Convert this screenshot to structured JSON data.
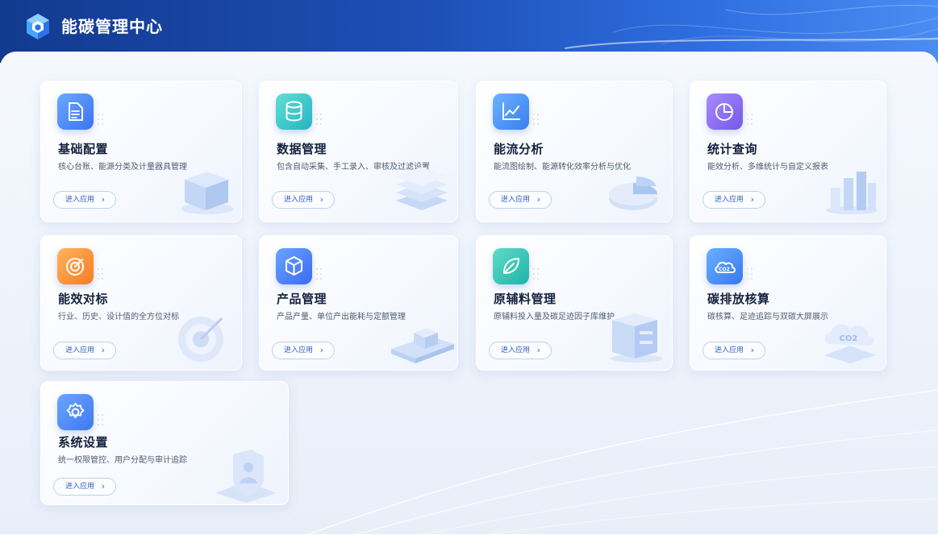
{
  "app": {
    "title": "能碳管理中心",
    "logo_icon": "hexagon-logo-icon"
  },
  "colors": {
    "header_start": "#123a8f",
    "header_end": "#4a8cf2",
    "title_text": "#14213d",
    "desc_text": "#4f5b70",
    "button_text": "#2f5fc4",
    "button_border": "#bcd0f0"
  },
  "cards": [
    {
      "title": "基础配置",
      "desc": "核心台账、能源分类及计量器具管理",
      "button": "进入应用",
      "icon": "document-icon",
      "art": "cube-illustration"
    },
    {
      "title": "数据管理",
      "desc": "包含自动采集、手工录入、审核及过滤设置",
      "button": "进入应用",
      "icon": "database-icon",
      "art": "stacked-layers-illustration"
    },
    {
      "title": "能流分析",
      "desc": "能流图绘制、能源转化效率分析与优化",
      "button": "进入应用",
      "icon": "line-chart-icon",
      "art": "pie-illustration"
    },
    {
      "title": "统计查询",
      "desc": "能效分析、多维统计与自定义报表",
      "button": "进入应用",
      "icon": "pie-chart-icon",
      "art": "bar-chart-illustration"
    },
    {
      "title": "能效对标",
      "desc": "行业、历史、设计值的全方位对标",
      "button": "进入应用",
      "icon": "target-icon",
      "art": "target-illustration"
    },
    {
      "title": "产品管理",
      "desc": "产品产量、单位产出能耗与定额管理",
      "button": "进入应用",
      "icon": "box-icon",
      "art": "conveyor-illustration"
    },
    {
      "title": "原辅料管理",
      "desc": "原辅料投入量及碳足迹因子库维护",
      "button": "进入应用",
      "icon": "leaf-icon",
      "art": "shelf-box-illustration"
    },
    {
      "title": "碳排放核算",
      "desc": "碳核算、足迹追踪与双碳大屏展示",
      "button": "进入应用",
      "icon": "co2-cloud-icon",
      "art": "co2-cloud-illustration"
    },
    {
      "title": "系统设置",
      "desc": "统一权限管控、用户分配与审计追踪",
      "button": "进入应用",
      "icon": "gear-icon",
      "art": "user-shield-illustration"
    }
  ],
  "co2_label": "CO2",
  "button_arrow": "›"
}
